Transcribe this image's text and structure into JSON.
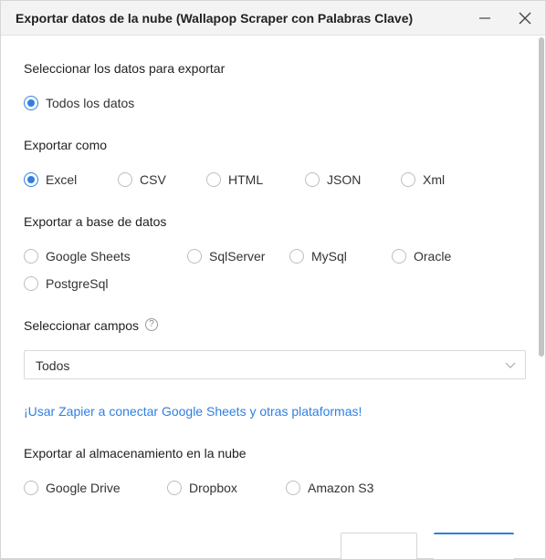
{
  "window": {
    "title": "Exportar datos de la nube (Wallapop Scraper con Palabras Clave)"
  },
  "sections": {
    "select_data": {
      "title": "Seleccionar los datos para exportar",
      "options": [
        {
          "label": "Todos los datos",
          "checked": true
        }
      ]
    },
    "export_as": {
      "title": "Exportar como",
      "options": [
        {
          "label": "Excel",
          "checked": true
        },
        {
          "label": "CSV",
          "checked": false
        },
        {
          "label": "HTML",
          "checked": false
        },
        {
          "label": "JSON",
          "checked": false
        },
        {
          "label": "Xml",
          "checked": false
        }
      ]
    },
    "export_db": {
      "title": "Exportar a base de datos",
      "options": [
        {
          "label": "Google Sheets",
          "checked": false
        },
        {
          "label": "SqlServer",
          "checked": false
        },
        {
          "label": "MySql",
          "checked": false
        },
        {
          "label": "Oracle",
          "checked": false
        },
        {
          "label": "PostgreSql",
          "checked": false
        }
      ]
    },
    "fields": {
      "title": "Seleccionar campos",
      "help_icon": "question-circle-icon",
      "select_value": "Todos"
    },
    "zapier_link": "¡Usar Zapier a conectar Google Sheets y otras plataformas!",
    "cloud": {
      "title": "Exportar al almacenamiento en la nube",
      "options": [
        {
          "label": "Google Drive",
          "checked": false
        },
        {
          "label": "Dropbox",
          "checked": false
        },
        {
          "label": "Amazon S3",
          "checked": false
        }
      ]
    }
  },
  "colors": {
    "accent": "#2f7fe0",
    "titlebar_bg": "#f3f3f3",
    "border": "#d6d6d6"
  }
}
